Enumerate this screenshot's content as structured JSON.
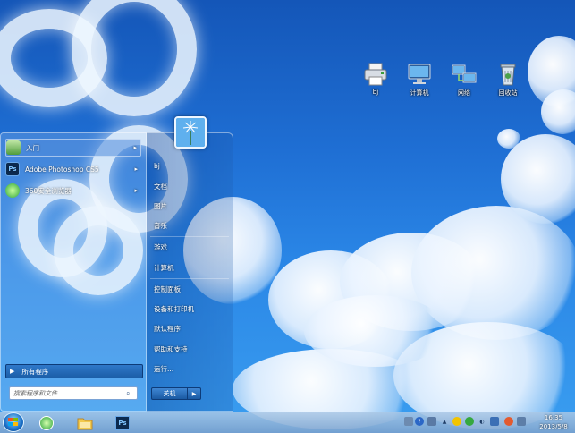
{
  "desktop_icons": [
    {
      "label": "bj",
      "icon": "printer-icon"
    },
    {
      "label": "计算机",
      "icon": "computer-icon"
    },
    {
      "label": "网络",
      "icon": "network-icon"
    },
    {
      "label": "回收站",
      "icon": "recycle-bin-icon"
    }
  ],
  "start_menu": {
    "pinned": [
      {
        "label": "入门",
        "icon": "getting-started-icon"
      },
      {
        "label": "Adobe Photoshop CS5",
        "icon": "photoshop-icon",
        "icon_text": "Ps"
      },
      {
        "label": "360安全浏览器",
        "icon": "browser-360-icon"
      }
    ],
    "all_programs": "所有程序",
    "search_placeholder": "搜索程序和文件",
    "right": [
      {
        "label": "bj"
      },
      {
        "label": "文档"
      },
      {
        "label": "图片"
      },
      {
        "label": "音乐"
      },
      {
        "label": "游戏"
      },
      {
        "label": "计算机"
      },
      {
        "label": "控制面板"
      },
      {
        "label": "设备和打印机"
      },
      {
        "label": "默认程序"
      },
      {
        "label": "帮助和支持"
      },
      {
        "label": "运行..."
      }
    ],
    "shutdown": "关机"
  },
  "taskbar": {
    "photoshop_text": "Ps",
    "clock_time": "16:35",
    "clock_date": "2013/5/8"
  },
  "colors": {
    "taskbar": "#7aa0cd",
    "accent": "#1b5ea8"
  }
}
